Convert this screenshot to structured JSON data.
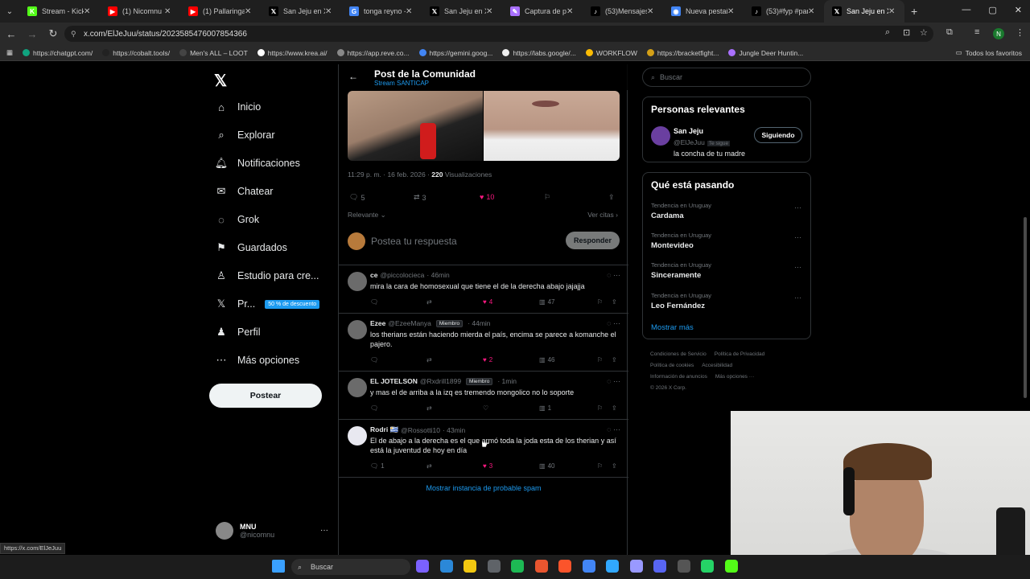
{
  "browser": {
    "tabs": [
      {
        "title": "Stream - Kick D",
        "icon_color": "#53fc18",
        "icon": "kick-icon",
        "glyph": "K"
      },
      {
        "title": "(1) Nicomnu -",
        "icon_color": "#ff0000",
        "icon": "youtube-icon",
        "glyph": "▶"
      },
      {
        "title": "(1) Pallaringas",
        "icon_color": "#ff0000",
        "icon": "youtube-icon",
        "glyph": "▶"
      },
      {
        "title": "San Jeju en X:",
        "icon_color": "#000000",
        "icon": "x-icon",
        "glyph": "𝕏"
      },
      {
        "title": "tonga reyno -",
        "icon_color": "#4285f4",
        "icon": "google-icon",
        "glyph": "G"
      },
      {
        "title": "San Jeju en X:",
        "icon_color": "#000000",
        "icon": "x-icon",
        "glyph": "𝕏"
      },
      {
        "title": "Captura de pa",
        "icon_color": "#a970ff",
        "icon": "edit-icon",
        "glyph": "✎"
      },
      {
        "title": "(53)Mensajes |",
        "icon_color": "#000000",
        "icon": "tiktok-icon",
        "glyph": "♪"
      },
      {
        "title": "Nueva pestaña",
        "icon_color": "#4285f4",
        "icon": "chrome-icon",
        "glyph": "◉"
      },
      {
        "title": "(53)#fyp #para",
        "icon_color": "#000000",
        "icon": "tiktok-icon",
        "glyph": "♪"
      },
      {
        "title": "San Jeju en X:",
        "icon_color": "#000000",
        "icon": "x-icon",
        "glyph": "𝕏",
        "active": true
      }
    ],
    "url": "x.com/ElJeJuu/status/2023585476007854366",
    "profile_initial": "N",
    "bookmarks": [
      {
        "label": "https://chatgpt.com/",
        "color": "#10a37f"
      },
      {
        "label": "https://cobalt.tools/",
        "color": "#222"
      },
      {
        "label": "Men's ALL – LOOT",
        "color": "#444"
      },
      {
        "label": "https://www.krea.ai/",
        "color": "#fff"
      },
      {
        "label": "https://app.reve.co...",
        "color": "#888"
      },
      {
        "label": "https://gemini.goog...",
        "color": "#4285f4"
      },
      {
        "label": "https://labs.google/...",
        "color": "#eee"
      },
      {
        "label": "WORKFLOW",
        "color": "#fbbc04"
      },
      {
        "label": "https://bracketfight...",
        "color": "#d4a017"
      },
      {
        "label": "Jungle Deer Huntin...",
        "color": "#a970ff"
      }
    ],
    "bookmarks_all": "Todos los favoritos",
    "status_url": "https://x.com/ElJeJuu"
  },
  "sidebar": {
    "items": [
      {
        "label": "Inicio",
        "icon": "home-icon",
        "glyph": "⌂"
      },
      {
        "label": "Explorar",
        "icon": "search-icon",
        "glyph": "⌕"
      },
      {
        "label": "Notificaciones",
        "icon": "bell-icon",
        "glyph": "🔔︎"
      },
      {
        "label": "Chatear",
        "icon": "mail-icon",
        "glyph": "✉"
      },
      {
        "label": "Grok",
        "icon": "grok-icon",
        "glyph": "◌"
      },
      {
        "label": "Guardados",
        "icon": "bookmark-icon",
        "glyph": "⚑"
      },
      {
        "label": "Estudio para cre...",
        "icon": "studio-icon",
        "glyph": "♙"
      },
      {
        "label": "Pr...",
        "icon": "x-premium-icon",
        "glyph": "𝕏"
      },
      {
        "label": "Perfil",
        "icon": "person-icon",
        "glyph": "♟"
      },
      {
        "label": "Más opciones",
        "icon": "more-circle-icon",
        "glyph": "⋯"
      }
    ],
    "premium_badge": "50 % de descuento",
    "post_button": "Postear",
    "me": {
      "name": "MNU",
      "handle": "@nicomnu"
    }
  },
  "post": {
    "header_title": "Post de la Comunidad",
    "header_sub": "Stream SANTICAP",
    "time": "11:29 p. m. · 16 feb. 2026 ·",
    "views": "220",
    "views_label": "Visualizaciones",
    "replies": "5",
    "reposts": "3",
    "likes": "10",
    "sort": "Relevante",
    "quotes": "Ver citas",
    "reply_placeholder": "Postea tu respuesta",
    "reply_button": "Responder"
  },
  "comments": [
    {
      "name": "ce",
      "handle": "@piccolocieca",
      "member": "",
      "time": "· 46min",
      "text": "mira la cara de homosexual que tiene el de la derecha abajo jajajja",
      "replies": "",
      "likes": "4",
      "views": "47",
      "liked": true
    },
    {
      "name": "Ezee",
      "handle": "@EzeeManya",
      "member": "Miembro",
      "time": "· 44min",
      "text": "los therians están haciendo mierda el país, encima se parece a komanche el pajero.",
      "replies": "",
      "likes": "2",
      "views": "46",
      "liked": true
    },
    {
      "name": "EL JOTELSON",
      "handle": "@Rxdrill1899",
      "member": "Miembro",
      "time": "· 1min",
      "text": "y mas el de arriba a la izq es tremendo mongolico no lo soporte",
      "replies": "",
      "likes": "",
      "views": "1",
      "liked": false
    },
    {
      "name": "Rodri 🇺🇾",
      "handle": "@Rossotti10",
      "member": "",
      "time": "· 43min",
      "text": "El de abajo a la derecha es el que armó toda la joda esta de los therian y así está la juventud de hoy en día",
      "replies": "1",
      "likes": "3",
      "views": "40",
      "liked": true
    }
  ],
  "spam_link": "Mostrar instancia de probable spam",
  "right": {
    "search_placeholder": "Buscar",
    "relevant_title": "Personas relevantes",
    "person": {
      "name": "San Jeju",
      "handle": "@ElJeJuu",
      "follows_you": "Te sigue",
      "bio": "la concha de tu madre",
      "button": "Siguiendo"
    },
    "trends_title": "Qué está pasando",
    "trends": [
      {
        "context": "Tendencia en Uruguay",
        "name": "Cardama"
      },
      {
        "context": "Tendencia en Uruguay",
        "name": "Montevideo"
      },
      {
        "context": "Tendencia en Uruguay",
        "name": "Sinceramente"
      },
      {
        "context": "Tendencia en Uruguay",
        "name": "Leo Fernández"
      }
    ],
    "show_more": "Mostrar más",
    "footer": [
      "Condiciones de Servicio",
      "Política de Privacidad",
      "Política de cookies",
      "Accesibilidad",
      "Información de anuncios",
      "Más opciones ···",
      "© 2026 X Corp."
    ]
  },
  "taskbar": {
    "search": "Buscar"
  }
}
